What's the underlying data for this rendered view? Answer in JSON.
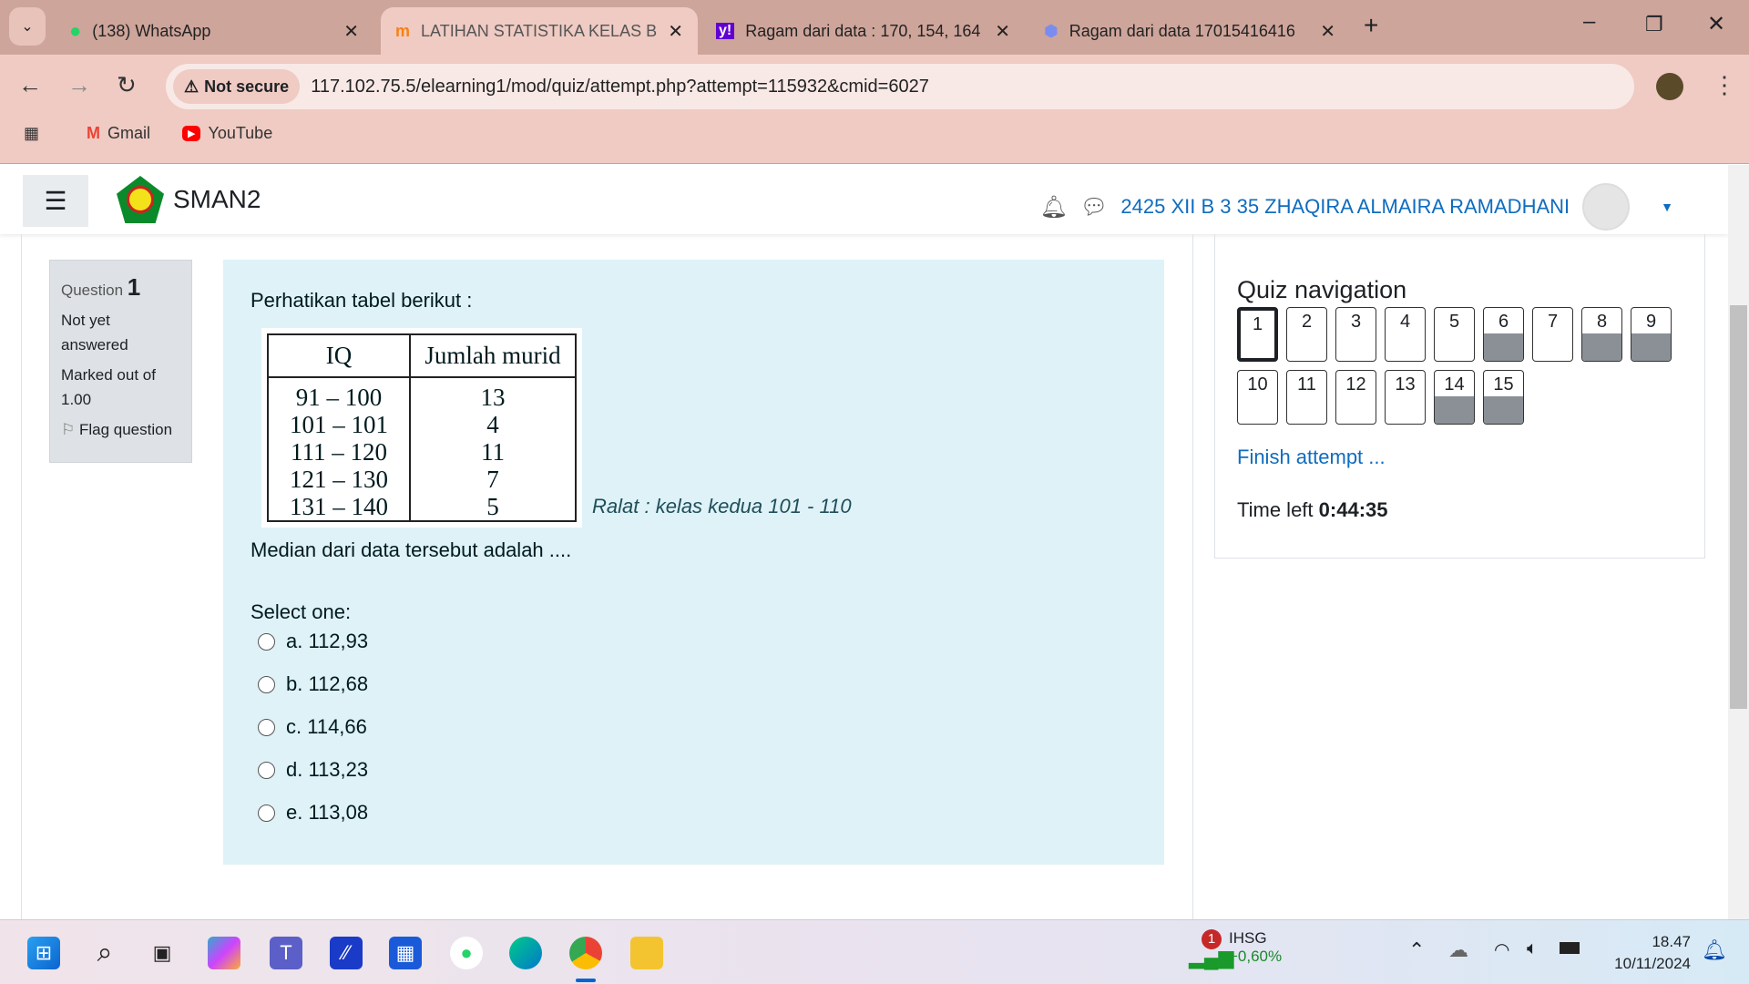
{
  "browser": {
    "tabs": [
      {
        "title": "(138) WhatsApp",
        "icon": "whatsapp-icon",
        "active": false
      },
      {
        "title": "LATIHAN STATISTIKA KELAS B (",
        "icon": "moodle-icon",
        "active": true
      },
      {
        "title": "Ragam dari data : 170, 154, 164",
        "icon": "yahoo-icon",
        "active": false
      },
      {
        "title": "Ragam dari data 17015416416",
        "icon": "gem-icon",
        "active": false
      }
    ],
    "security": "Not secure",
    "url": "117.102.75.5/elearning1/mod/quiz/attempt.php?attempt=115932&cmid=6027",
    "bookmarks": [
      {
        "label": "Gmail"
      },
      {
        "label": "YouTube"
      }
    ]
  },
  "navbar": {
    "site": "SMAN2",
    "user": "2425 XII B 3 35 ZHAQIRA ALMAIRA RAMADHANI"
  },
  "question": {
    "label": "Question",
    "number": "1",
    "status": "Not yet answered",
    "marked": "Marked out of 1.00",
    "flag": "Flag question",
    "intro": "Perhatikan tabel berikut :",
    "table": {
      "headers": [
        "IQ",
        "Jumlah murid"
      ],
      "rows": [
        [
          "91 – 100",
          "13"
        ],
        [
          "101 – 101",
          "4"
        ],
        [
          "111 – 120",
          "11"
        ],
        [
          "121 – 130",
          "7"
        ],
        [
          "131 – 140",
          "5"
        ]
      ]
    },
    "ralat": "Ralat : kelas kedua 101 - 110",
    "prompt": "Median dari data tersebut adalah ....",
    "select": "Select one:",
    "options": [
      "a. 112,93",
      "b. 112,68",
      "c. 114,66",
      "d. 113,23",
      "e. 113,08"
    ]
  },
  "quiznav": {
    "title": "Quiz navigation",
    "buttons": [
      {
        "n": "1",
        "current": true,
        "answered": false
      },
      {
        "n": "2",
        "answered": false
      },
      {
        "n": "3",
        "answered": false
      },
      {
        "n": "4",
        "answered": false
      },
      {
        "n": "5",
        "answered": false
      },
      {
        "n": "6",
        "answered": true
      },
      {
        "n": "7",
        "answered": false
      },
      {
        "n": "8",
        "answered": true
      },
      {
        "n": "9",
        "answered": true
      },
      {
        "n": "10",
        "answered": false
      },
      {
        "n": "11",
        "answered": false
      },
      {
        "n": "12",
        "answered": false
      },
      {
        "n": "13",
        "answered": false
      },
      {
        "n": "14",
        "answered": true
      },
      {
        "n": "15",
        "answered": true
      }
    ],
    "finish": "Finish attempt ...",
    "time_label": "Time left",
    "time": "0:44:35"
  },
  "taskbar": {
    "stock": "IHSG",
    "stock_change": "+0,60%",
    "badge": "1",
    "time": "18.47",
    "date": "10/11/2024"
  }
}
